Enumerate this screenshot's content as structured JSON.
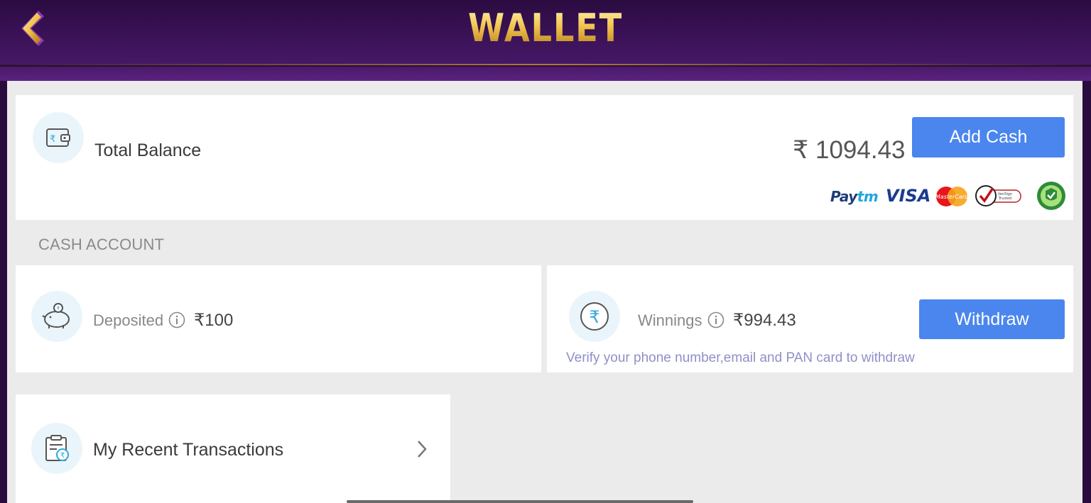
{
  "header": {
    "title": "WALLET",
    "back_icon": "back-chevron-icon"
  },
  "balance": {
    "label": "Total Balance",
    "amount": "₹ 1094.43",
    "add_cash_label": "Add Cash",
    "icon": "wallet-icon",
    "payment_logos": [
      "Paytm",
      "VISA",
      "MasterCard",
      "VeriSign Trusted",
      "verified-badge"
    ]
  },
  "cash_account": {
    "title": "CASH ACCOUNT",
    "deposited": {
      "label": "Deposited",
      "amount": "₹100",
      "icon": "piggy-bank-icon"
    },
    "winnings": {
      "label": "Winnings",
      "amount": "₹994.43",
      "icon": "rupee-coin-icon",
      "withdraw_label": "Withdraw",
      "verify_note": "Verify your phone number,email and PAN card to withdraw"
    }
  },
  "transactions": {
    "label": "My Recent Transactions",
    "icon": "transactions-icon"
  },
  "colors": {
    "accent": "#4a86ee",
    "header_bg": "#3a1257",
    "title_gold": "#f2c64f"
  }
}
